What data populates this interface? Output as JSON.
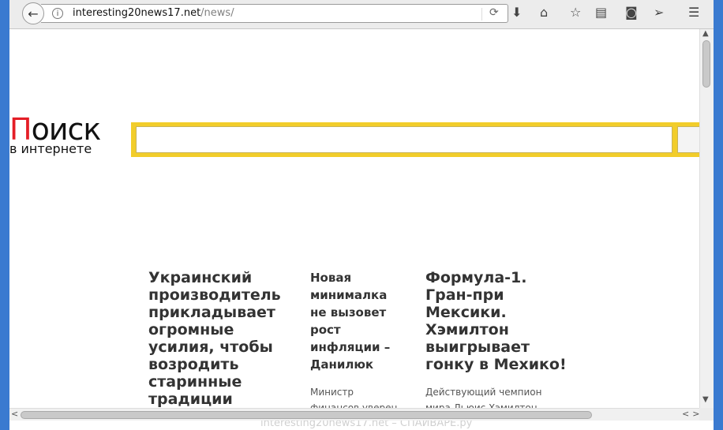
{
  "browser": {
    "url_host": "interesting20news17.net",
    "url_path": "/news/",
    "icons": [
      "back-arrow-icon",
      "info-icon",
      "reload-icon",
      "download-icon",
      "home-icon",
      "bookmark-star-icon",
      "reader-view-icon",
      "pocket-icon",
      "send-icon",
      "menu-icon"
    ]
  },
  "page": {
    "logo_main_first": "П",
    "logo_main_rest": "оиск",
    "logo_sub": "в интернете",
    "news": [
      {
        "title": "Украинский производитель прикладывает огромные усилия, чтобы возродить старинные традиции",
        "text": ""
      },
      {
        "title": "Новая минималка не вызовет рост инфляции – Данилюк",
        "text": "Министр финансов уверен, что повышение"
      },
      {
        "title": "Формула-1. Гран-при Мексики. Хэмилтон выигрывает гонку в Мехико!",
        "text": "Действующий чемпион мира Льюис Хэмилтон одержал"
      }
    ]
  },
  "watermark": "interesting20news17.net – СПАЙВАРЕ.ру",
  "colors": {
    "search_frame": "#f2cd2a",
    "logo_accent": "#e41e26",
    "window_edge": "#3a7ad0"
  }
}
